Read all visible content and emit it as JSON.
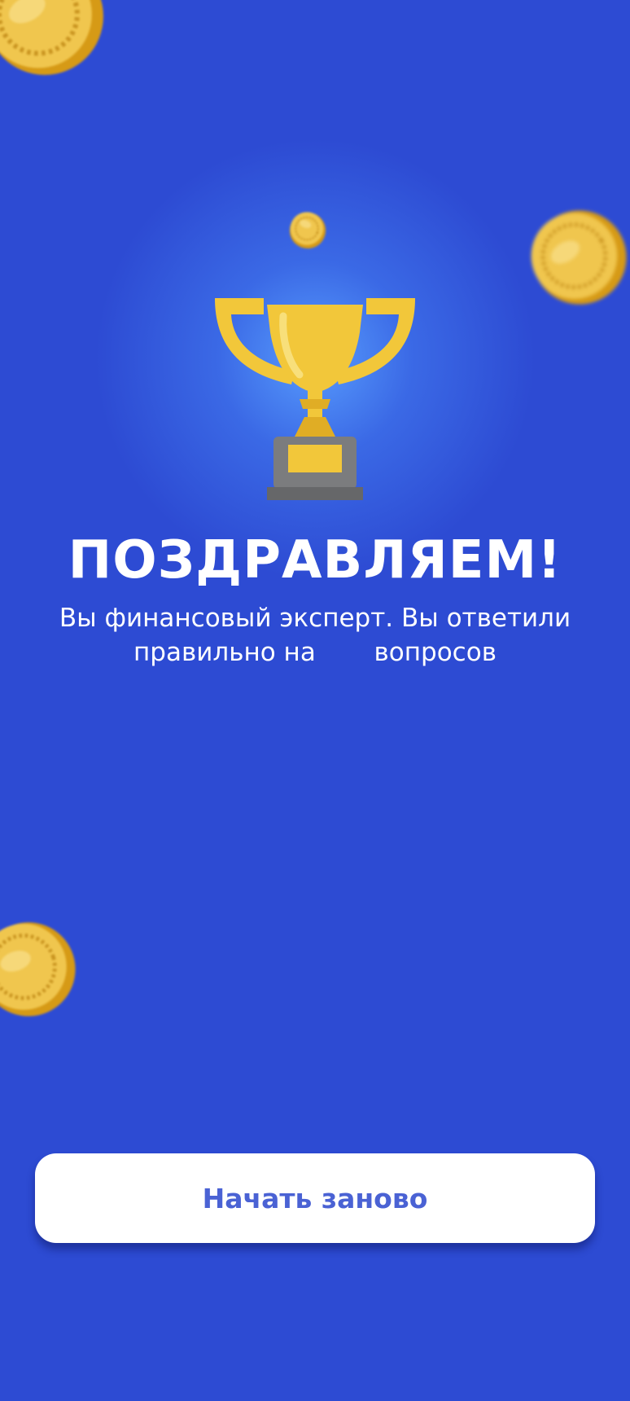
{
  "colors": {
    "background": "#2d4bd3",
    "title": "#ffffff",
    "subtitle": "#ffffff",
    "button_background": "#ffffff",
    "button_text": "#4a62d4",
    "trophy_gold": "#f2c73a",
    "trophy_gold_dark": "#e0ad25",
    "trophy_base": "#7b7c7e",
    "trophy_base_dark": "#666769"
  },
  "icons": {
    "trophy": "trophy-icon",
    "coins": "gold-coin-icon"
  },
  "result": {
    "title": "ПОЗДРАВЛЯЕМ!",
    "subtitle_line1": "Вы финансовый эксперт. Вы ответили",
    "subtitle_line2_before": "правильно на",
    "correct_count": "",
    "subtitle_line2_after": "вопросов"
  },
  "actions": {
    "restart_label": "Начать заново"
  }
}
